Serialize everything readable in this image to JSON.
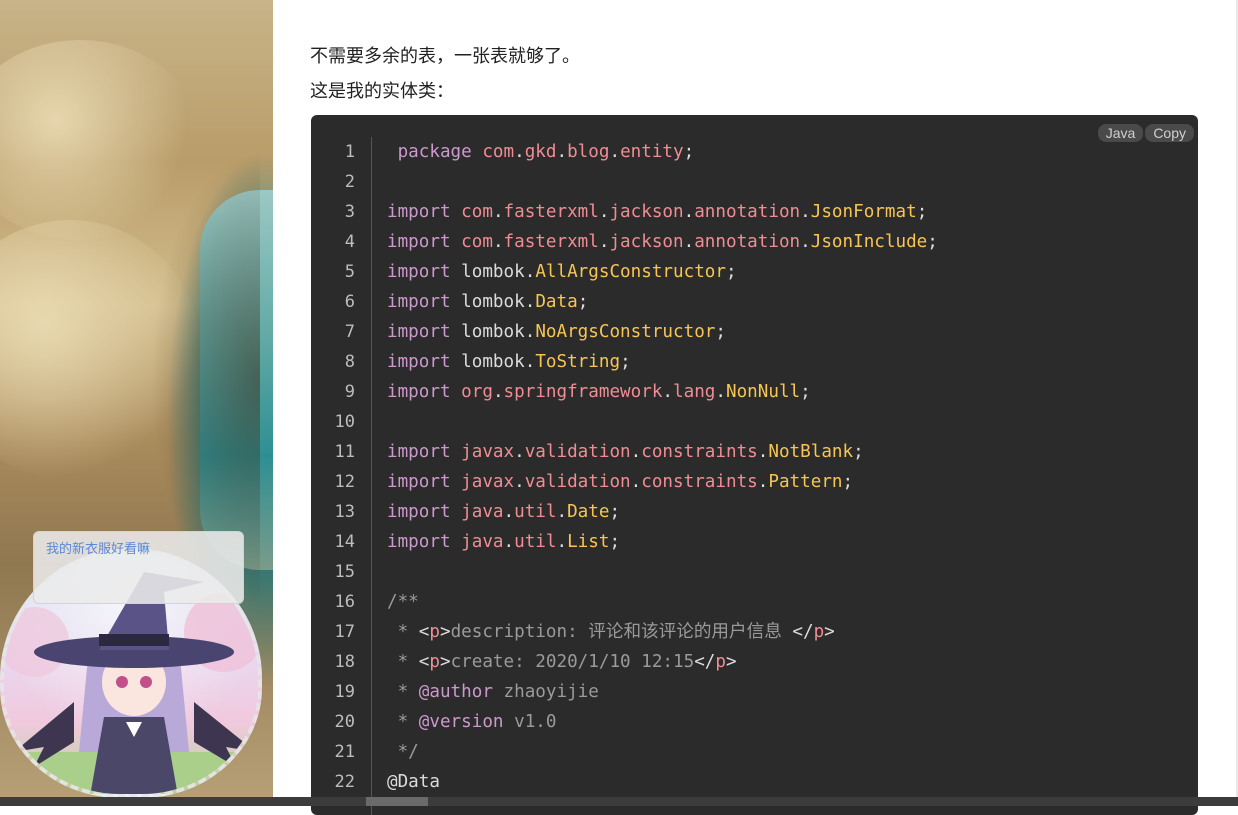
{
  "page": {
    "paragraph_1": "不需要多余的表，一张表就够了。",
    "paragraph_2": "这是我的实体类："
  },
  "widget": {
    "bubble_text": "我的新衣服好看嘛"
  },
  "code_block": {
    "language_label": "Java",
    "copy_label": "Copy",
    "line_numbers": [
      "1",
      "2",
      "3",
      "4",
      "5",
      "6",
      "7",
      "8",
      "9",
      "10",
      "11",
      "12",
      "13",
      "14",
      "15",
      "16",
      "17",
      "18",
      "19",
      "20",
      "21",
      "22"
    ]
  },
  "colors": {
    "code_bg": "#2b2b2b",
    "keyword": "#cc99cd",
    "package": "#f08d94",
    "class": "#f8c555",
    "comment": "#9a9a9a",
    "bubble_text": "#5b87d6"
  }
}
